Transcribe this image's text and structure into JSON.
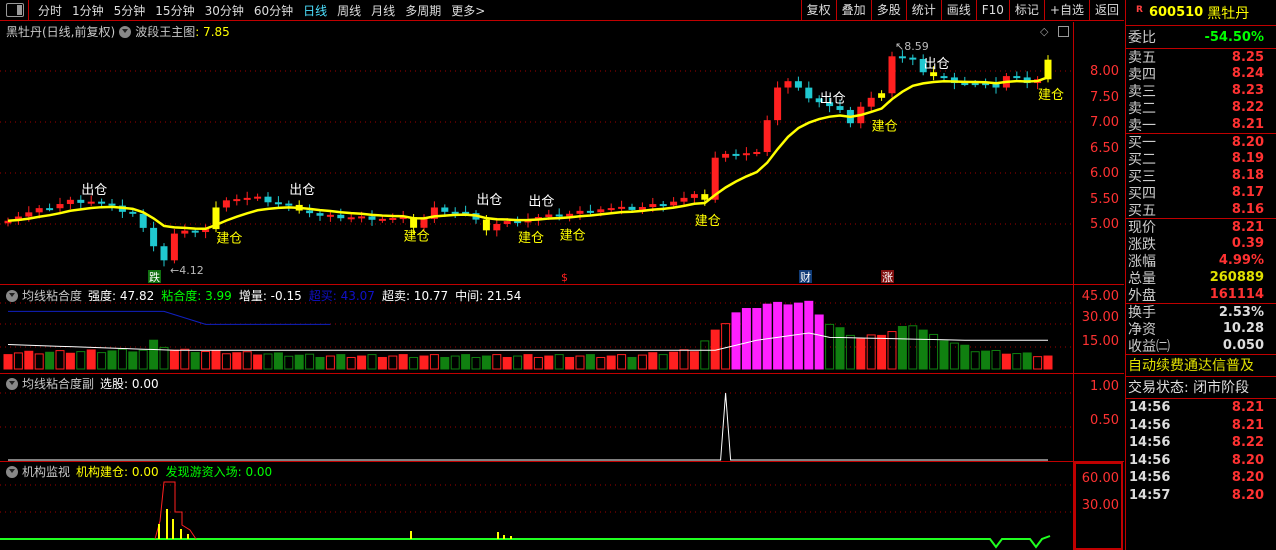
{
  "toolbar": {
    "periods": [
      "分时",
      "1分钟",
      "5分钟",
      "15分钟",
      "30分钟",
      "60分钟",
      "日线",
      "周线",
      "月线",
      "多周期",
      "更多>"
    ],
    "active": "日线",
    "buttons": [
      "复权",
      "叠加",
      "多股",
      "统计",
      "画线",
      "F10",
      "标记",
      "+自选",
      "返回"
    ]
  },
  "stock": {
    "badge": "R",
    "code": "600510",
    "name": "黑牡丹"
  },
  "main_pane": {
    "title": "黑牡丹(日线,前复权)",
    "indicator": "波段王主图",
    "indicator_value": ": 7.85",
    "high_label": "8.59",
    "low_label": "4.12",
    "axis": [
      "8.00",
      "7.50",
      "7.00",
      "6.50",
      "6.00",
      "5.50",
      "5.00"
    ],
    "signals": {
      "out": "出仓",
      "in": "建仓"
    },
    "markers": [
      {
        "text": "跌",
        "color": "#107010"
      },
      {
        "text": "$",
        "color": "#000"
      },
      {
        "text": "财",
        "color": "#103c78"
      },
      {
        "text": "涨",
        "color": "#801010"
      }
    ]
  },
  "pane2": {
    "title": "均线粘合度",
    "items": [
      {
        "label": "强度: 47.82",
        "color": "#ffffff"
      },
      {
        "label": "粘合度: 3.99",
        "color": "#00ff00"
      },
      {
        "label": "增量: -0.15",
        "color": "#ffffff"
      },
      {
        "label": "超买: 43.07",
        "color": "#1010c8"
      },
      {
        "label": "超卖: 10.77",
        "color": "#ffffff"
      },
      {
        "label": "中间: 21.54",
        "color": "#ffffff"
      }
    ],
    "axis": [
      "45.00",
      "30.00",
      "15.00"
    ]
  },
  "pane3": {
    "title": "均线粘合度副",
    "items": [
      {
        "label": "选股: 0.00",
        "color": "#ffffff"
      }
    ],
    "axis": [
      "1.00",
      "0.50"
    ]
  },
  "pane4": {
    "title": "机构监视",
    "items": [
      {
        "label": "机构建仓: 0.00",
        "color": "#ffff00"
      },
      {
        "label": "发现游资入场: 0.00",
        "color": "#00ff00"
      }
    ],
    "axis": [
      "60.00",
      "30.00"
    ]
  },
  "quote": {
    "weibi": {
      "label": "委比",
      "value": "-54.50%"
    },
    "asks": [
      {
        "label": "卖五",
        "value": "8.25"
      },
      {
        "label": "卖四",
        "value": "8.24"
      },
      {
        "label": "卖三",
        "value": "8.23"
      },
      {
        "label": "卖二",
        "value": "8.22"
      },
      {
        "label": "卖一",
        "value": "8.21"
      }
    ],
    "bids": [
      {
        "label": "买一",
        "value": "8.20"
      },
      {
        "label": "买二",
        "value": "8.19"
      },
      {
        "label": "买三",
        "value": "8.18"
      },
      {
        "label": "买四",
        "value": "8.17"
      },
      {
        "label": "买五",
        "value": "8.16"
      }
    ],
    "stats1": [
      {
        "label": "现价",
        "value": "8.21",
        "c": "red"
      },
      {
        "label": "涨跌",
        "value": "0.39",
        "c": "red"
      },
      {
        "label": "涨幅",
        "value": "4.99%",
        "c": "red"
      },
      {
        "label": "总量",
        "value": "260889",
        "c": "yellow"
      },
      {
        "label": "外盘",
        "value": "161114",
        "c": "red"
      }
    ],
    "stats2": [
      {
        "label": "换手",
        "value": "2.53%"
      },
      {
        "label": "净资",
        "value": "10.28"
      },
      {
        "label": "收益㈡",
        "value": "0.050"
      }
    ],
    "notice": "自动续费通达信普及",
    "status": "交易状态: 闭市阶段",
    "ticks": [
      {
        "t": "14:56",
        "p": "8.21"
      },
      {
        "t": "14:56",
        "p": "8.21"
      },
      {
        "t": "14:56",
        "p": "8.22"
      },
      {
        "t": "14:56",
        "p": "8.20"
      },
      {
        "t": "14:56",
        "p": "8.20"
      },
      {
        "t": "14:57",
        "p": "8.20"
      }
    ]
  },
  "chart_data": {
    "type": "candlestick",
    "price_keypoints": [
      [
        0,
        5.1
      ],
      [
        6,
        5.45
      ],
      [
        8,
        5.45
      ],
      [
        12,
        5.2
      ],
      [
        14,
        4.6
      ],
      [
        15,
        4.3
      ],
      [
        16,
        4.8
      ],
      [
        19,
        4.9
      ],
      [
        20,
        5.3
      ],
      [
        21,
        5.5
      ],
      [
        24,
        5.5
      ],
      [
        28,
        5.3
      ],
      [
        30,
        5.15
      ],
      [
        38,
        5.1
      ],
      [
        39,
        4.95
      ],
      [
        40,
        5.1
      ],
      [
        41,
        5.3
      ],
      [
        43,
        5.25
      ],
      [
        44,
        5.2
      ],
      [
        46,
        4.9
      ],
      [
        47,
        5.0
      ],
      [
        50,
        5.1
      ],
      [
        54,
        5.2
      ],
      [
        57,
        5.3
      ],
      [
        60,
        5.3
      ],
      [
        63,
        5.4
      ],
      [
        66,
        5.55
      ],
      [
        67,
        5.5
      ],
      [
        68,
        6.3
      ],
      [
        70,
        6.4
      ],
      [
        72,
        6.4
      ],
      [
        73,
        7.0
      ],
      [
        74,
        7.7
      ],
      [
        75,
        7.8
      ],
      [
        77,
        7.5
      ],
      [
        79,
        7.3
      ],
      [
        80,
        7.2
      ],
      [
        81,
        7.0
      ],
      [
        82,
        7.3
      ],
      [
        84,
        7.6
      ],
      [
        85,
        8.3
      ],
      [
        87,
        8.2
      ],
      [
        88,
        8.0
      ],
      [
        89,
        7.9
      ],
      [
        91,
        7.8
      ],
      [
        93,
        7.75
      ],
      [
        95,
        7.7
      ],
      [
        96,
        7.9
      ],
      [
        98,
        7.8
      ],
      [
        99,
        7.85
      ],
      [
        100,
        8.21
      ]
    ],
    "signal_bars": [
      20,
      28,
      39,
      46,
      67,
      84,
      89,
      100
    ],
    "out_bars": [
      8,
      28,
      46,
      51,
      79,
      89
    ],
    "in_bars": [
      21,
      39,
      50,
      54,
      67,
      84,
      100
    ],
    "strength_keypoints": [
      [
        0,
        10
      ],
      [
        13,
        12
      ],
      [
        14,
        18
      ],
      [
        16,
        12
      ],
      [
        30,
        8
      ],
      [
        60,
        8
      ],
      [
        66,
        12
      ],
      [
        68,
        25
      ],
      [
        70,
        38
      ],
      [
        73,
        44
      ],
      [
        77,
        45
      ],
      [
        79,
        30
      ],
      [
        82,
        20
      ],
      [
        85,
        25
      ],
      [
        87,
        30
      ],
      [
        89,
        22
      ],
      [
        93,
        12
      ],
      [
        100,
        8
      ]
    ],
    "overbought_keypoints": [
      [
        0,
        40
      ],
      [
        15,
        40
      ],
      [
        19,
        31
      ],
      [
        31,
        31
      ]
    ],
    "middle_keypoints": [
      [
        0,
        17
      ],
      [
        16,
        13
      ],
      [
        68,
        13
      ],
      [
        72,
        20
      ],
      [
        77,
        25
      ],
      [
        79,
        22
      ],
      [
        92,
        20
      ],
      [
        100,
        20
      ]
    ],
    "select_spike_bar": 69,
    "ylim": [
      4.0,
      8.8
    ]
  }
}
